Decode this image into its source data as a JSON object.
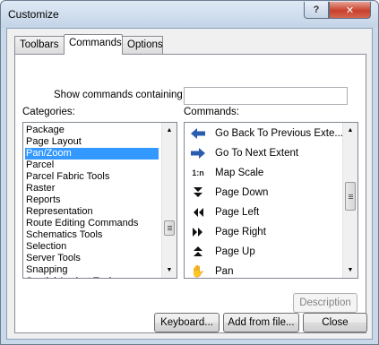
{
  "window": {
    "title": "Customize",
    "help_glyph": "?",
    "close_glyph": "✕"
  },
  "tabs": [
    {
      "label": "Toolbars",
      "active": false
    },
    {
      "label": "Commands",
      "active": true
    },
    {
      "label": "Options",
      "active": false
    }
  ],
  "search": {
    "label": "Show commands containing:",
    "value": ""
  },
  "categories": {
    "header": "Categories:",
    "selected": "Pan/Zoom",
    "items": [
      "Package",
      "Page Layout",
      "Pan/Zoom",
      "Parcel",
      "Parcel Fabric Tools",
      "Raster",
      "Reports",
      "Representation",
      "Route Editing Commands",
      "Schematics Tools",
      "Selection",
      "Server Tools",
      "Snapping",
      "Spatial Analyst Tools"
    ]
  },
  "commands": {
    "header": "Commands:",
    "items": [
      {
        "label": "Go Back To Previous Exte...",
        "icon": "arrow-left-icon"
      },
      {
        "label": "Go To Next Extent",
        "icon": "arrow-right-icon"
      },
      {
        "label": "Map Scale",
        "icon": "map-scale-icon",
        "glyph": "1:n"
      },
      {
        "label": "Page Down",
        "icon": "page-down-icon"
      },
      {
        "label": "Page Left",
        "icon": "page-left-icon"
      },
      {
        "label": "Page Right",
        "icon": "page-right-icon"
      },
      {
        "label": "Page Up",
        "icon": "page-up-icon"
      },
      {
        "label": "Pan",
        "icon": "hand-pan-icon",
        "glyph": "✋"
      }
    ]
  },
  "buttons": {
    "description": "Description",
    "keyboard": "Keyboard...",
    "add_from_file": "Add from file...",
    "close": "Close"
  }
}
